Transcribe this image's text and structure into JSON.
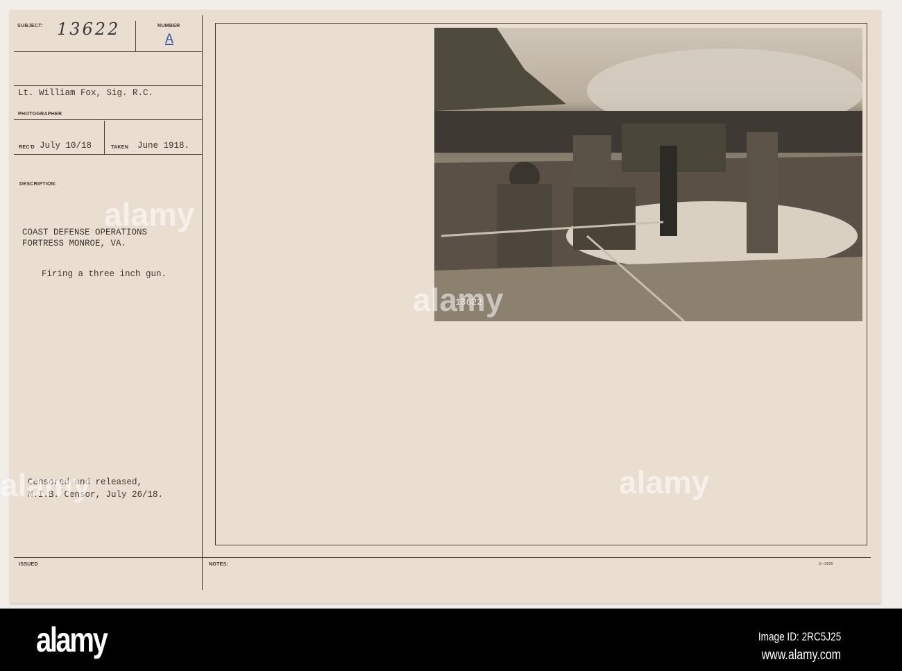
{
  "card": {
    "subject_label": "SUBJECT:",
    "subject_value": "13622",
    "number_label": "NUMBER",
    "number_value": "A",
    "photographer_value": "Lt. William Fox, Sig. R.C.",
    "photographer_label": "PHOTOGRAPHER",
    "recd_label": "REC'D",
    "recd_value": "July 10/18",
    "taken_label": "TAKEN",
    "taken_value": "June 1918.",
    "description_label": "DESCRIPTION:",
    "description_line1": "COAST DEFENSE OPERATIONS",
    "description_line2": "FORTRESS MONROE, VA.",
    "caption": "Firing a three inch gun.",
    "censor_line1": "Censored and released,",
    "censor_line2": "M.I.B. Censor, July 26/18.",
    "issued_label": "ISSUED",
    "notes_label": "NOTES:",
    "form_number": "3—5605",
    "photo_number": "13622"
  },
  "watermark": {
    "brand": "alamy",
    "image_id": "Image ID: 2RC5J25",
    "site": "www.alamy.com"
  },
  "colors": {
    "card": "#e9ded0",
    "ink_blue": "#3d5aa8"
  }
}
